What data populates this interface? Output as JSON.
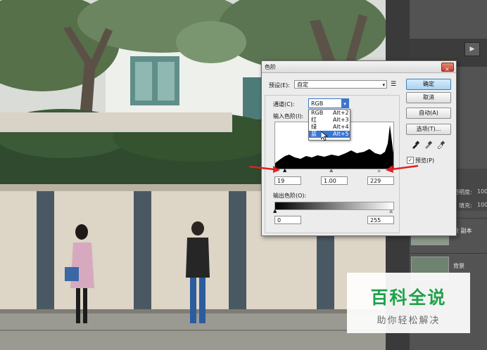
{
  "dialog": {
    "title": "色阶",
    "close_glyph": "×",
    "preset_label": "预设(E):",
    "preset_value": "自定",
    "channel_label": "通道(C):",
    "channel_value": "RGB",
    "input_levels_label": "输入色阶(I):",
    "input_black": "19",
    "input_mid": "1.00",
    "input_white": "229",
    "output_levels_label": "输出色阶(O):",
    "output_black": "0",
    "output_white": "255",
    "channel_options": [
      {
        "name": "RGB",
        "shortcut": "Alt+2"
      },
      {
        "name": "红",
        "shortcut": "Alt+3"
      },
      {
        "name": "绿",
        "shortcut": "Alt+4"
      },
      {
        "name": "蓝",
        "shortcut": "Alt+5"
      }
    ],
    "selected_channel_index": 3,
    "buttons": {
      "ok": "确定",
      "cancel": "取消",
      "auto": "自动(A)",
      "options": "选项(T)..."
    },
    "preview_label": "预览(P)",
    "preview_checked": true
  },
  "side_panel": {
    "opacity_label": "透明度:",
    "opacity_value": "100",
    "fill_label": "填充:",
    "fill_value": "100",
    "layer_name": "录 副本",
    "bottom_layer_name": "背景",
    "play_glyph": "▶"
  },
  "watermark": {
    "logo_text": "百科全说",
    "sub_text": "助你轻松解决"
  },
  "colors": {
    "accent_selection": "#3a76d0",
    "ok_button": "#a9d3f2",
    "arrow_red": "#e02020",
    "watermark_green": "#1fa24a"
  }
}
